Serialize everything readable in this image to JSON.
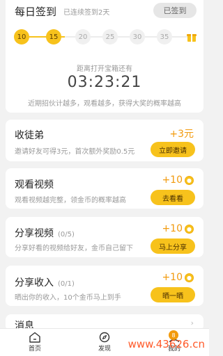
{
  "checkin": {
    "title": "每日签到",
    "streak_text": "已连续签到2天",
    "button": "已签到",
    "days": [
      {
        "label": "10",
        "done": true
      },
      {
        "label": "15",
        "done": true
      },
      {
        "label": "20",
        "done": false
      },
      {
        "label": "25",
        "done": false
      },
      {
        "label": "30",
        "done": false
      },
      {
        "label": "35",
        "done": false
      }
    ],
    "gift_icon": "gift-box-icon",
    "countdown_label": "距离打开宝箱还有",
    "countdown": "03:23:21",
    "description": "近期招伙计越多，观看越多，获得大奖的概率越高"
  },
  "tasks": [
    {
      "title": "收徒弟",
      "count": "",
      "desc": "邀请好友可得3元，首次额外奖励0.5元",
      "reward": "+3元",
      "coin": false,
      "button": "立即邀请"
    },
    {
      "title": "观看视频",
      "count": "",
      "desc": "观看视频越完整，领金币的概率越高",
      "reward": "+10",
      "coin": true,
      "button": "去看看"
    },
    {
      "title": "分享视频",
      "count": "(0/5)",
      "desc": "分享好看的视频给好友，金币自己留下",
      "reward": "+10",
      "coin": true,
      "button": "马上分享"
    },
    {
      "title": "分享收入",
      "count": "(0/1)",
      "desc": "晒出你的收入，10个金币马上到手",
      "reward": "+10",
      "coin": true,
      "button": "晒一晒"
    }
  ],
  "partial_card": {
    "title": "消息"
  },
  "nav": {
    "home": "首页",
    "discover": "发现",
    "mine": "我的",
    "mine_badge": "8"
  },
  "watermark": "www.43626.cn",
  "colors": {
    "accent": "#f7c21c",
    "reward": "#f29a0d"
  }
}
